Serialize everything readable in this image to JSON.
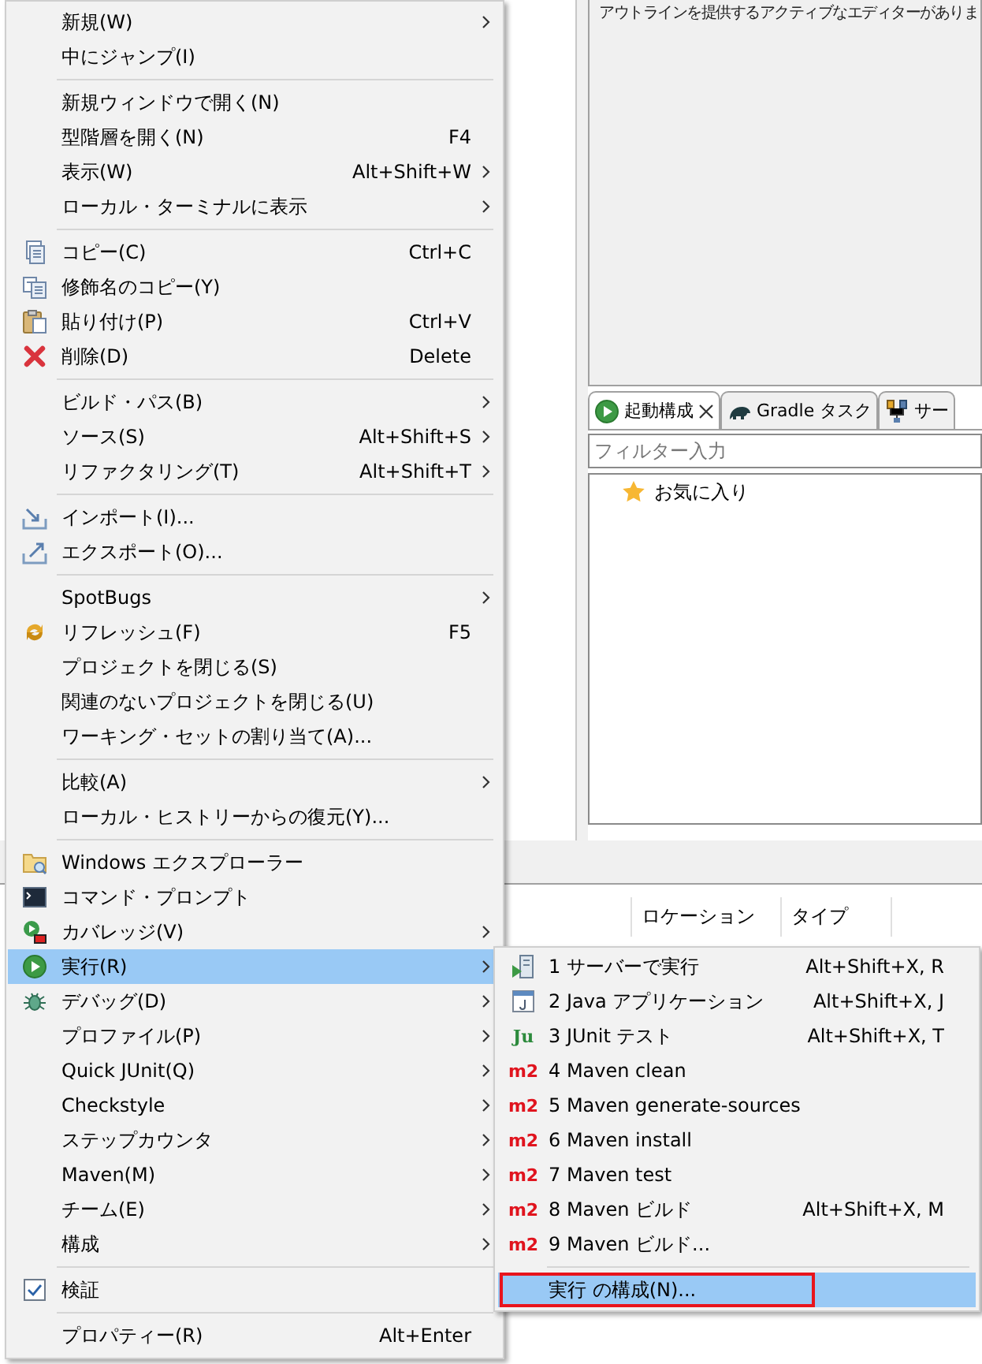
{
  "outline_view": {
    "message": "アウトラインを提供するアクティブなエディターがありま"
  },
  "launch_view": {
    "tabs": [
      {
        "label": "起動構成",
        "selected": true,
        "closable": true
      },
      {
        "label": "Gradle タスク",
        "selected": false,
        "closable": false
      },
      {
        "label": "サー",
        "selected": false,
        "closable": false
      }
    ],
    "filter": {
      "placeholder": "フィルター入力"
    },
    "tree": [
      {
        "label": "お気に入り"
      }
    ]
  },
  "bottom_table": {
    "columns": [
      "ロケーション",
      "タイプ"
    ]
  },
  "context_menu": {
    "sections": [
      [
        {
          "kind": "command",
          "label": "新規(W)",
          "submenu": true,
          "selected": false
        },
        {
          "kind": "command",
          "label": "中にジャンプ(I)",
          "submenu": false,
          "selected": false
        }
      ],
      [
        {
          "kind": "command",
          "label": "新規ウィンドウで開く(N)",
          "submenu": false,
          "selected": false
        },
        {
          "kind": "command",
          "label": "型階層を開く(N)",
          "shortcut": "F4",
          "submenu": false,
          "selected": false
        },
        {
          "kind": "command",
          "label": "表示(W)",
          "shortcut": "Alt+Shift+W",
          "submenu": true,
          "selected": false
        },
        {
          "kind": "command",
          "label": "ローカル・ターミナルに表示",
          "submenu": true,
          "selected": false
        }
      ],
      [
        {
          "kind": "command",
          "label": "コピー(C)",
          "shortcut": "Ctrl+C",
          "submenu": false,
          "selected": false
        },
        {
          "kind": "command",
          "label": "修飾名のコピー(Y)",
          "submenu": false,
          "selected": false
        },
        {
          "kind": "command",
          "label": "貼り付け(P)",
          "shortcut": "Ctrl+V",
          "submenu": false,
          "selected": false
        },
        {
          "kind": "command",
          "label": "削除(D)",
          "shortcut": "Delete",
          "submenu": false,
          "selected": false
        }
      ],
      [
        {
          "kind": "command",
          "label": "ビルド・パス(B)",
          "submenu": true,
          "selected": false
        },
        {
          "kind": "command",
          "label": "ソース(S)",
          "shortcut": "Alt+Shift+S",
          "submenu": true,
          "selected": false
        },
        {
          "kind": "command",
          "label": "リファクタリング(T)",
          "shortcut": "Alt+Shift+T",
          "submenu": true,
          "selected": false
        }
      ],
      [
        {
          "kind": "command",
          "label": "インポート(I)...",
          "submenu": false,
          "selected": false
        },
        {
          "kind": "command",
          "label": "エクスポート(O)...",
          "submenu": false,
          "selected": false
        }
      ],
      [
        {
          "kind": "command",
          "label": "SpotBugs",
          "submenu": true,
          "selected": false
        },
        {
          "kind": "command",
          "label": "リフレッシュ(F)",
          "shortcut": "F5",
          "submenu": false,
          "selected": false
        },
        {
          "kind": "command",
          "label": "プロジェクトを閉じる(S)",
          "submenu": false,
          "selected": false
        },
        {
          "kind": "command",
          "label": "関連のないプロジェクトを閉じる(U)",
          "submenu": false,
          "selected": false
        },
        {
          "kind": "command",
          "label": "ワーキング・セットの割り当て(A)...",
          "submenu": false,
          "selected": false
        }
      ],
      [
        {
          "kind": "command",
          "label": "比較(A)",
          "submenu": true,
          "selected": false
        },
        {
          "kind": "command",
          "label": "ローカル・ヒストリーからの復元(Y)...",
          "submenu": false,
          "selected": false
        }
      ],
      [
        {
          "kind": "command",
          "label": "Windows エクスプローラー",
          "submenu": false,
          "selected": false
        },
        {
          "kind": "command",
          "label": "コマンド・プロンプト",
          "submenu": false,
          "selected": false
        },
        {
          "kind": "command",
          "label": "カバレッジ(V)",
          "submenu": true,
          "selected": false
        },
        {
          "kind": "command",
          "label": "実行(R)",
          "submenu": true,
          "selected": true
        },
        {
          "kind": "command",
          "label": "デバッグ(D)",
          "submenu": true,
          "selected": false
        },
        {
          "kind": "command",
          "label": "プロファイル(P)",
          "submenu": true,
          "selected": false
        },
        {
          "kind": "command",
          "label": "Quick JUnit(Q)",
          "submenu": true,
          "selected": false
        },
        {
          "kind": "command",
          "label": "Checkstyle",
          "submenu": true,
          "selected": false
        },
        {
          "kind": "command",
          "label": "ステップカウンタ",
          "submenu": true,
          "selected": false
        },
        {
          "kind": "command",
          "label": "Maven(M)",
          "submenu": true,
          "selected": false
        },
        {
          "kind": "command",
          "label": "チーム(E)",
          "submenu": true,
          "selected": false
        },
        {
          "kind": "command",
          "label": "構成",
          "submenu": true,
          "selected": false
        }
      ],
      [
        {
          "kind": "check",
          "label": "検証",
          "checked": true,
          "submenu": false,
          "selected": false
        }
      ],
      [
        {
          "kind": "command",
          "label": "プロパティー(R)",
          "shortcut": "Alt+Enter",
          "submenu": false,
          "selected": false
        }
      ]
    ]
  },
  "submenu": {
    "sections": [
      [
        {
          "label": "1 サーバーで実行",
          "shortcut": "Alt+Shift+X, R",
          "selected": false,
          "outlined": false
        },
        {
          "label": "2 Java アプリケーション",
          "shortcut": "Alt+Shift+X, J",
          "selected": false,
          "outlined": false
        },
        {
          "label": "3 JUnit テスト",
          "badge": "Ju",
          "shortcut": "Alt+Shift+X, T",
          "selected": false,
          "outlined": false
        },
        {
          "label": "4 Maven clean",
          "badge": "m2",
          "selected": false,
          "outlined": false
        },
        {
          "label": "5 Maven generate-sources",
          "badge": "m2",
          "selected": false,
          "outlined": false
        },
        {
          "label": "6 Maven install",
          "badge": "m2",
          "selected": false,
          "outlined": false
        },
        {
          "label": "7 Maven test",
          "badge": "m2",
          "selected": false,
          "outlined": false
        },
        {
          "label": "8 Maven ビルド",
          "badge": "m2",
          "shortcut": "Alt+Shift+X, M",
          "selected": false,
          "outlined": false
        },
        {
          "label": "9 Maven ビルド...",
          "badge": "m2",
          "selected": false,
          "outlined": false
        }
      ],
      [
        {
          "label": "実行 の構成(N)...",
          "selected": true,
          "outlined": true
        }
      ]
    ]
  }
}
